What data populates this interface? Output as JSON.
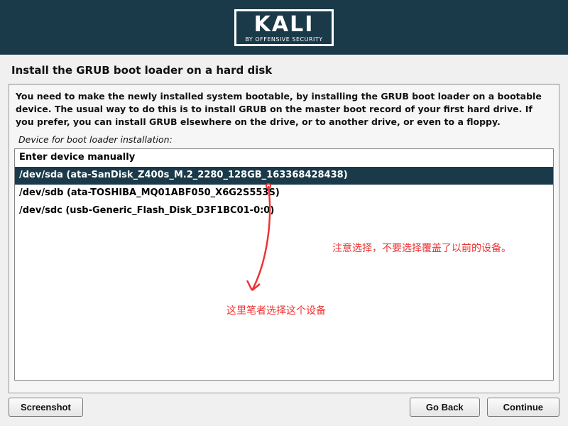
{
  "logo": {
    "title": "KALI",
    "subtitle": "BY OFFENSIVE SECURITY"
  },
  "page_title": "Install the GRUB boot loader on a hard disk",
  "instruction": "You need to make the newly installed system bootable, by installing the GRUB boot loader on a bootable device. The usual way to do this is to install GRUB on the master boot record of your first hard drive. If you prefer, you can install GRUB elsewhere on the drive, or to another drive, or even to a floppy.",
  "field_label": "Device for boot loader installation:",
  "devices": [
    {
      "label": "Enter device manually",
      "selected": false
    },
    {
      "label": "/dev/sda  (ata-SanDisk_Z400s_M.2_2280_128GB_163368428438)",
      "selected": true
    },
    {
      "label": "/dev/sdb  (ata-TOSHIBA_MQ01ABF050_X6G2S553S)",
      "selected": false
    },
    {
      "label": "/dev/sdc  (usb-Generic_Flash_Disk_D3F1BC01-0:0)",
      "selected": false
    }
  ],
  "buttons": {
    "screenshot": "Screenshot",
    "go_back": "Go Back",
    "cont": "Continue"
  },
  "annotations": {
    "warn": "注意选择，不要选择覆盖了以前的设备。",
    "pick": "这里笔者选择这个设备"
  }
}
